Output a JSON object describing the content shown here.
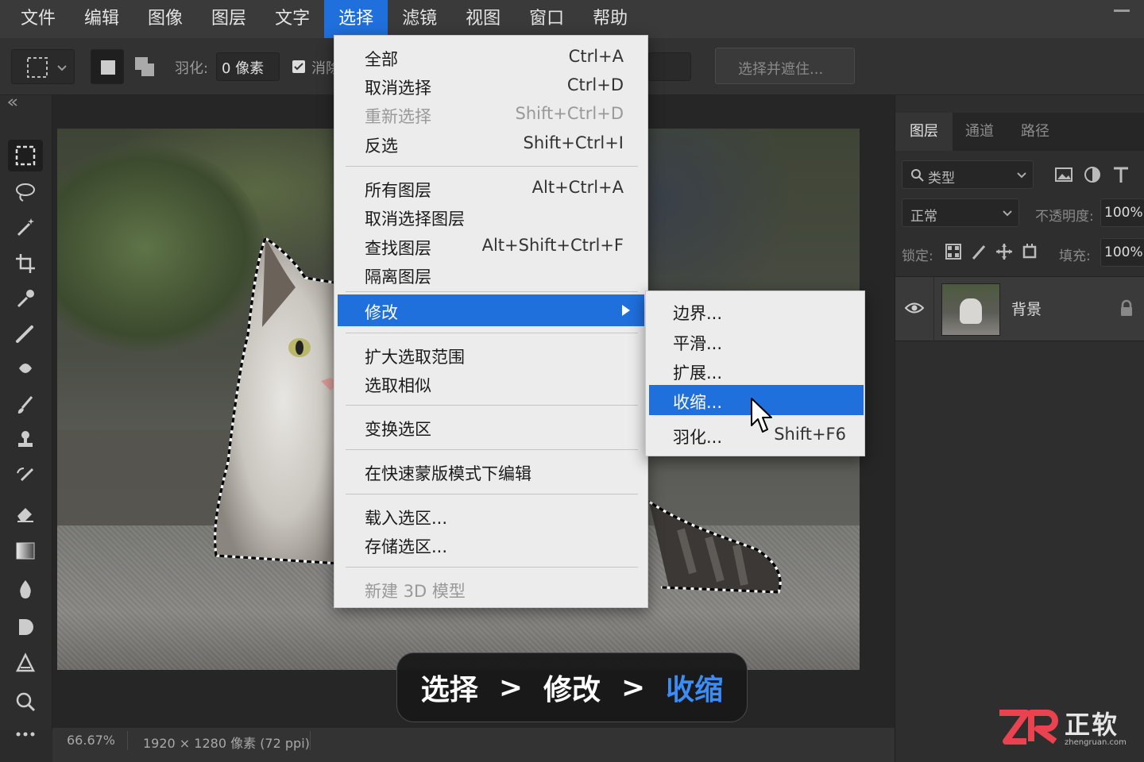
{
  "menubar": {
    "items": [
      "文件",
      "编辑",
      "图像",
      "图层",
      "文字",
      "选择",
      "滤镜",
      "视图",
      "窗口",
      "帮助"
    ],
    "active_index": 5
  },
  "options_bar": {
    "feather_label": "羽化:",
    "feather_value": "0 像素",
    "antialias_label": "消除",
    "select_mask_button": "选择并遮住..."
  },
  "select_menu": {
    "groups": [
      [
        {
          "label": "全部",
          "shortcut": "Ctrl+A"
        },
        {
          "label": "取消选择",
          "shortcut": "Ctrl+D"
        },
        {
          "label": "重新选择",
          "shortcut": "Shift+Ctrl+D",
          "disabled": true
        },
        {
          "label": "反选",
          "shortcut": "Shift+Ctrl+I"
        }
      ],
      [
        {
          "label": "所有图层",
          "shortcut": "Alt+Ctrl+A"
        },
        {
          "label": "取消选择图层",
          "shortcut": ""
        },
        {
          "label": "查找图层",
          "shortcut": "Alt+Shift+Ctrl+F"
        },
        {
          "label": "隔离图层",
          "shortcut": ""
        }
      ],
      [
        {
          "label": "修改",
          "shortcut": "",
          "submenu": true,
          "highlighted": true
        }
      ],
      [
        {
          "label": "扩大选取范围",
          "shortcut": ""
        },
        {
          "label": "选取相似",
          "shortcut": ""
        }
      ],
      [
        {
          "label": "变换选区",
          "shortcut": ""
        }
      ],
      [
        {
          "label": "在快速蒙版模式下编辑",
          "shortcut": ""
        }
      ],
      [
        {
          "label": "载入选区...",
          "shortcut": ""
        },
        {
          "label": "存储选区...",
          "shortcut": ""
        }
      ],
      [
        {
          "label": "新建 3D 模型",
          "shortcut": "",
          "disabled": true
        }
      ]
    ]
  },
  "modify_submenu": {
    "items": [
      {
        "label": "边界...",
        "shortcut": ""
      },
      {
        "label": "平滑...",
        "shortcut": ""
      },
      {
        "label": "扩展...",
        "shortcut": ""
      },
      {
        "label": "收缩...",
        "shortcut": "",
        "highlighted": true
      },
      {
        "label": "羽化...",
        "shortcut": "Shift+F6"
      }
    ]
  },
  "panel": {
    "tabs": [
      "图层",
      "通道",
      "路径"
    ],
    "filter_placeholder": "类型",
    "blend_mode": "正常",
    "opacity_label": "不透明度:",
    "opacity_value": "100%",
    "lock_label": "锁定:",
    "fill_label": "填充:",
    "fill_value": "100%",
    "layer_name": "背景"
  },
  "statusbar": {
    "zoom": "66.67%",
    "doc_info": "1920 × 1280 像素 (72 ppi)"
  },
  "caption": {
    "step1": "选择",
    "arrow": ">",
    "step2": "修改",
    "step3": "收缩"
  },
  "watermark": {
    "brand_cn": "正软",
    "brand_url": "zhengruan.com"
  },
  "colors": {
    "accent": "#1f6fdc",
    "caption_highlight": "#3b8cf5",
    "watermark_red": "#e8434f"
  }
}
